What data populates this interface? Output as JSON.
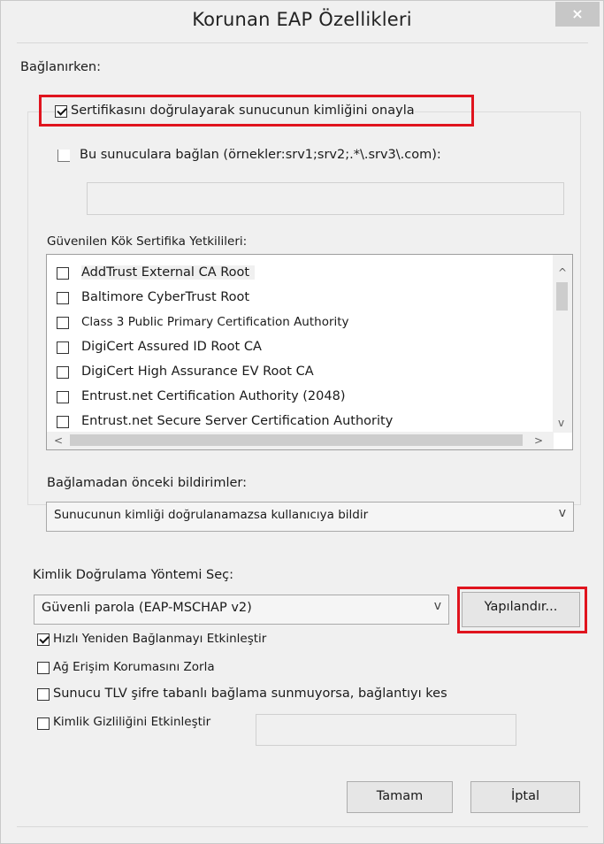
{
  "window": {
    "title": "Korunan EAP Özellikleri",
    "close_glyph": "×"
  },
  "connecting": {
    "heading": "Bağlanırken:",
    "verify_cert": {
      "label": "Sertifikasını doğrulayarak sunucunun kimliğini onayla",
      "checked": true
    },
    "connect_servers": {
      "label": "Bu sunuculara bağlan (örnekler:srv1;srv2;.*\\.srv3\\.com):",
      "checked": false,
      "value": ""
    },
    "trusted_ca_heading": "Güvenilen Kök Sertifika Yetkilileri:",
    "trusted_ca_list": [
      {
        "label": "AddTrust External CA Root",
        "checked": false
      },
      {
        "label": "Baltimore CyberTrust Root",
        "checked": false
      },
      {
        "label": "Class 3 Public Primary Certification Authority",
        "checked": false
      },
      {
        "label": "DigiCert Assured ID Root CA",
        "checked": false
      },
      {
        "label": "DigiCert High Assurance EV Root CA",
        "checked": false
      },
      {
        "label": "Entrust.net Certification Authority (2048)",
        "checked": false
      },
      {
        "label": "Entrust.net Secure Server Certification Authority",
        "checked": false
      }
    ],
    "scroll_up": "^",
    "scroll_down": "v",
    "scroll_left": "<",
    "scroll_right": ">",
    "notifications_heading": "Bağlamadan önceki bildirimler:",
    "notifications_value": "Sunucunun kimliği doğrulanamazsa kullanıcıya bildir",
    "dropdown_glyph": "v"
  },
  "auth": {
    "heading": "Kimlik Doğrulama Yöntemi Seç:",
    "method_value": "Güvenli parola (EAP-MSCHAP v2)",
    "configure_button": "Yapılandır...",
    "options": [
      {
        "label": "Hızlı Yeniden Bağlanmayı Etkinleştir",
        "checked": true
      },
      {
        "label": "Ağ Erişim Korumasını Zorla",
        "checked": false
      },
      {
        "label": "Sunucu TLV şifre tabanlı bağlama sunmuyorsa, bağlantıyı kes",
        "checked": false
      },
      {
        "label": "Kimlik Gizliliğini Etkinleştir",
        "checked": false
      }
    ],
    "identity_privacy_value": ""
  },
  "buttons": {
    "ok": "Tamam",
    "cancel": "İptal"
  },
  "colors": {
    "highlight_border": "#e0141e",
    "window_bg": "#f0f0f0"
  }
}
